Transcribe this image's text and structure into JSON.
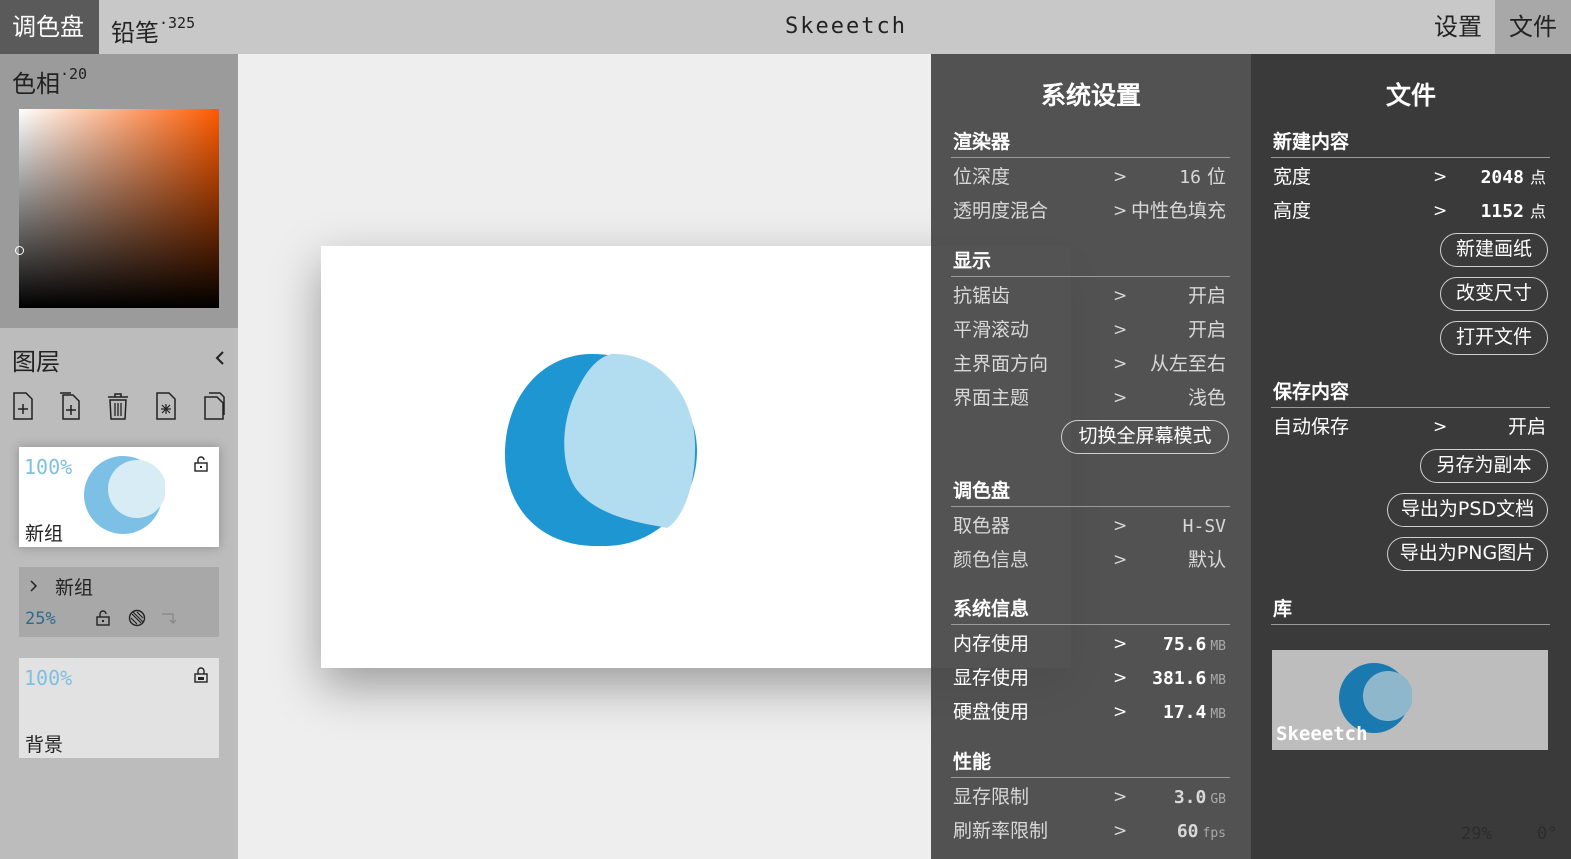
{
  "topbar": {
    "palette_tab": "调色盘",
    "pencil_tab": "铅笔",
    "pencil_size": "325",
    "app_title": "Skeeetch",
    "settings_tab": "设置",
    "file_tab": "文件"
  },
  "palette": {
    "hue_label": "色相",
    "hue_value": "20"
  },
  "layers": {
    "title": "图层",
    "items": [
      {
        "opacity": "100%",
        "name": "新组"
      },
      {
        "opacity": "25%",
        "name": "新组"
      },
      {
        "opacity": "100%",
        "name": "背景"
      }
    ]
  },
  "settings": {
    "title": "系统设置",
    "renderer": {
      "header": "渲染器",
      "bit_depth_label": "位深度",
      "bit_depth_value": "16",
      "bit_depth_unit": "位",
      "blend_label": "透明度混合",
      "blend_value": "中性色填充"
    },
    "display": {
      "header": "显示",
      "antialias_label": "抗锯齿",
      "antialias_value": "开启",
      "smooth_label": "平滑滚动",
      "smooth_value": "开启",
      "direction_label": "主界面方向",
      "direction_value": "从左至右",
      "theme_label": "界面主题",
      "theme_value": "浅色",
      "fullscreen_button": "切换全屏幕模式"
    },
    "palette": {
      "header": "调色盘",
      "picker_label": "取色器",
      "picker_value": "H-SV",
      "colorinfo_label": "颜色信息",
      "colorinfo_value": "默认"
    },
    "sysinfo": {
      "header": "系统信息",
      "ram_label": "内存使用",
      "ram_value": "75.6",
      "ram_unit": "MB",
      "vram_label": "显存使用",
      "vram_value": "381.6",
      "vram_unit": "MB",
      "disk_label": "硬盘使用",
      "disk_value": "17.4",
      "disk_unit": "MB"
    },
    "performance": {
      "header": "性能",
      "vram_limit_label": "显存限制",
      "vram_limit_value": "3.0",
      "vram_limit_unit": "GB",
      "fps_limit_label": "刷新率限制",
      "fps_limit_value": "60",
      "fps_limit_unit": "fps"
    }
  },
  "file": {
    "title": "文件",
    "new_content": {
      "header": "新建内容",
      "width_label": "宽度",
      "width_value": "2048",
      "width_unit": "点",
      "height_label": "高度",
      "height_value": "1152",
      "height_unit": "点",
      "new_paper_button": "新建画纸",
      "resize_button": "改变尺寸",
      "open_button": "打开文件"
    },
    "save_content": {
      "header": "保存内容",
      "autosave_label": "自动保存",
      "autosave_value": "开启",
      "save_copy_button": "另存为副本",
      "export_psd_button": "导出为PSD文档",
      "export_png_button": "导出为PNG图片"
    },
    "library": {
      "header": "库",
      "item_caption": "Skeeetch"
    }
  },
  "status": {
    "zoom": "29%",
    "rotation": "0°"
  },
  "arrow": ">",
  "colors": {
    "ink_dark": "#1e96d2",
    "ink_light": "#b2dcf0",
    "hue_color": "#ff5a00"
  }
}
